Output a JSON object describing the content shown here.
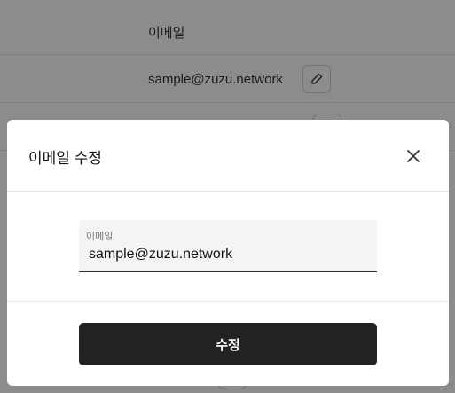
{
  "background": {
    "email_row_label": "이메일",
    "email_value": "sample@zuzu.network"
  },
  "modal": {
    "title": "이메일 수정",
    "field_label": "이메일",
    "field_value": "sample@zuzu.network",
    "submit_label": "수정"
  },
  "icons": {
    "close": "close-icon",
    "edit": "pencil-icon"
  }
}
